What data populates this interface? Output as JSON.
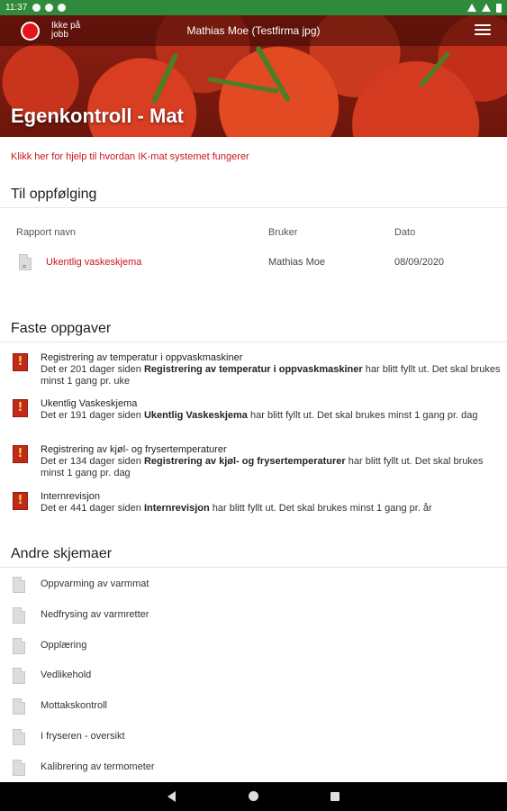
{
  "statusbar": {
    "time": "11:37"
  },
  "header": {
    "status_label": "Ikke på jobb",
    "user": "Mathias Moe (Testfirma jpg)",
    "title": "Egenkontroll - Mat"
  },
  "help_link": "Klikk her for hjelp til hvordan IK-mat systemet fungerer",
  "followup": {
    "title": "Til oppfølging",
    "columns": [
      "Rapport navn",
      "Bruker",
      "Dato"
    ],
    "rows": [
      {
        "name": "Ukentlig vaskeskjema",
        "user": "Mathias Moe",
        "date": "08/09/2020"
      }
    ]
  },
  "tasks": {
    "title": "Faste oppgaver",
    "items": [
      {
        "title": "Registrering av temperatur i oppvaskmaskiner",
        "pre": "Det er 201 dager siden ",
        "bold": "Registrering av temperatur i oppvaskmaskiner",
        "post": " har blitt fyllt ut. Det skal brukes minst 1 gang pr. uke"
      },
      {
        "title": "Ukentlig Vaskeskjema",
        "pre": "Det er 191 dager siden ",
        "bold": "Ukentlig Vaskeskjema",
        "post": " har blitt fyllt ut. Det skal brukes minst 1 gang pr. dag"
      },
      {
        "title": "Registrering av kjøl- og frysertemperaturer",
        "pre": "Det er 134 dager siden ",
        "bold": "Registrering av kjøl- og frysertemperaturer",
        "post": " har blitt fyllt ut. Det skal brukes minst 1 gang pr. dag"
      },
      {
        "title": "Internrevisjon",
        "pre": "Det er 441 dager siden ",
        "bold": "Internrevisjon",
        "post": " har blitt fyllt ut. Det skal brukes minst 1 gang pr. år"
      }
    ]
  },
  "forms": {
    "title": "Andre skjemaer",
    "items": [
      "Oppvarming av varmmat",
      "Nedfrysing av varmretter",
      "Opplæring",
      "Vedlikehold",
      "Mottakskontroll",
      "I fryseren - oversikt",
      "Kalibrering av termometer"
    ]
  }
}
